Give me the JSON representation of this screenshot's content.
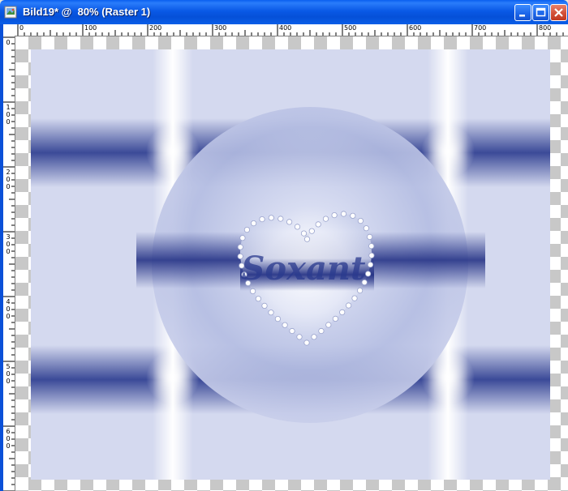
{
  "window": {
    "title": "Bild19* @  80% (Raster 1)",
    "title_color": "#ffffff",
    "titlebar_color": "#0a5ee8",
    "buttons": [
      "minimize-icon",
      "maximize-icon",
      "close-icon"
    ]
  },
  "ruler_top": {
    "labels": [
      "0",
      "100",
      "200",
      "300",
      "400",
      "500",
      "600",
      "700",
      "800"
    ]
  },
  "ruler_left": {
    "labels": [
      "0",
      "100",
      "200",
      "300",
      "400",
      "500",
      "600"
    ]
  },
  "canvas": {
    "background": "transparency-checkerboard",
    "colors": {
      "navy": "#2a3a8e",
      "light": "#dfe3f3",
      "white": "#ffffff"
    },
    "watermark_text": "Soxant"
  }
}
